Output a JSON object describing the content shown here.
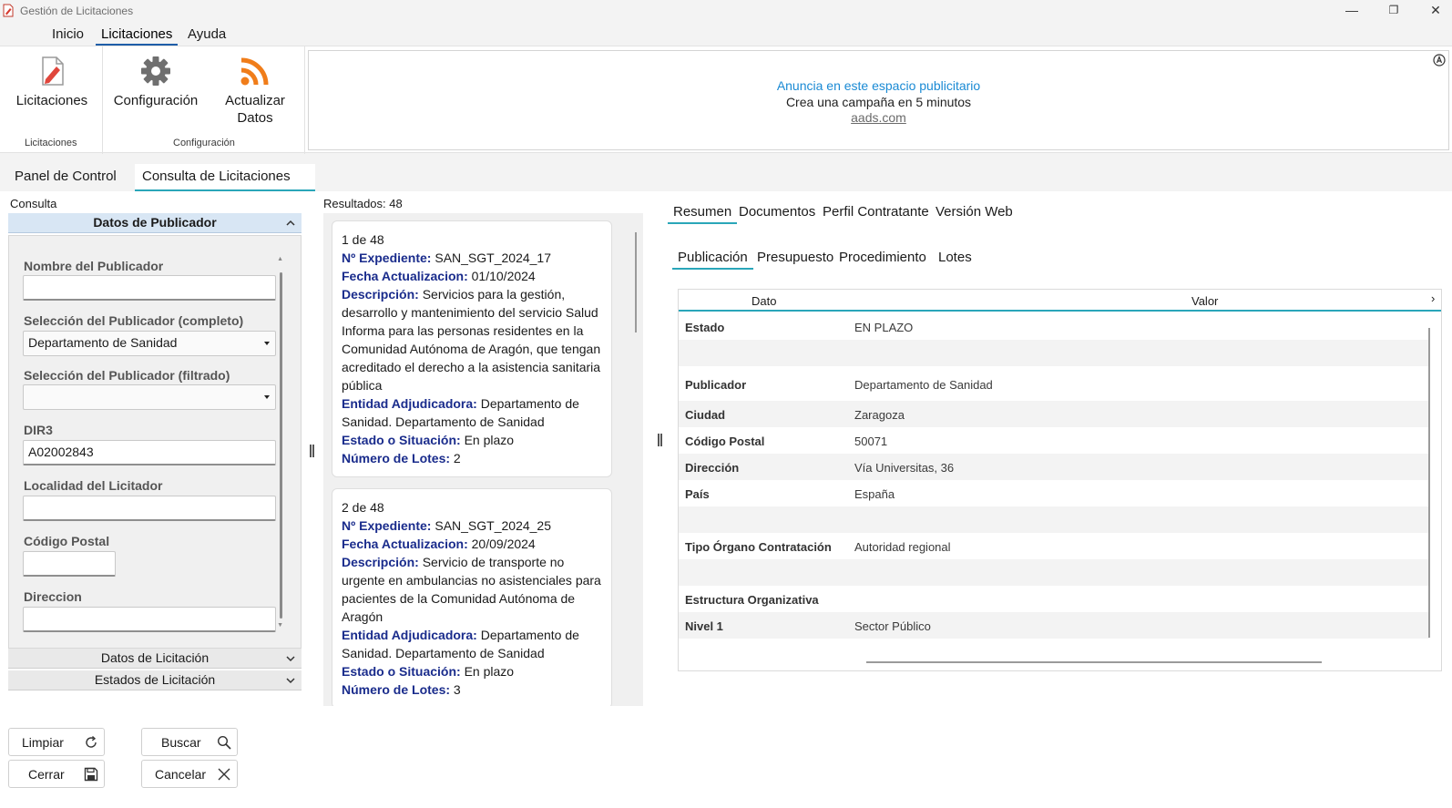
{
  "window": {
    "title": "Gestión de Licitaciones",
    "minimize_glyph": "—",
    "maximize_glyph": "❐",
    "close_glyph": "✕"
  },
  "menu": {
    "items": [
      "Inicio",
      "Licitaciones",
      "Ayuda"
    ],
    "active": "Licitaciones"
  },
  "ribbon": {
    "buttons": [
      {
        "label": "Licitaciones",
        "icon": "document-edit-icon"
      },
      {
        "label": "Configuración",
        "icon": "gear-icon"
      },
      {
        "label_line1": "Actualizar",
        "label_line2": "Datos",
        "icon": "rss-icon"
      }
    ],
    "groups": [
      "Licitaciones",
      "Configuración"
    ]
  },
  "ad": {
    "headline": "Anuncia en este espacio publicitario",
    "subline": "Crea una campaña en 5 minutos",
    "link": "aads.com"
  },
  "tabs": {
    "items": [
      "Panel de Control",
      "Consulta de Licitaciones"
    ],
    "active": "Consulta de Licitaciones"
  },
  "left": {
    "consulta_label": "Consulta",
    "accordion": {
      "publicador": "Datos de Publicador",
      "licitacion": "Datos de Licitación",
      "estados": "Estados de Licitación"
    },
    "form": {
      "nombre_label": "Nombre del Publicador",
      "nombre_value": "",
      "sel_completo_label": "Selección del Publicador (completo)",
      "sel_completo_value": "Departamento de Sanidad",
      "sel_filtrado_label": "Selección del Publicador (filtrado)",
      "sel_filtrado_value": "",
      "dir3_label": "DIR3",
      "dir3_value": "A02002843",
      "localidad_label": "Localidad del Licitador",
      "localidad_value": "",
      "cp_label": "Código Postal",
      "cp_value": "",
      "direccion_label": "Direccion",
      "direccion_value": ""
    },
    "buttons": {
      "limpiar": "Limpiar",
      "buscar": "Buscar",
      "cerrar": "Cerrar",
      "cancelar": "Cancelar"
    }
  },
  "results": {
    "label": "Resultados: 48",
    "field_labels": {
      "expediente": "Nº Expediente:",
      "fecha": "Fecha Actualizacion:",
      "descripcion": "Descripción:",
      "entidad": "Entidad Adjudicadora:",
      "estado": "Estado o Situación:",
      "lotes": "Número de Lotes:"
    },
    "cards": [
      {
        "index": "1 de 48",
        "expediente": "SAN_SGT_2024_17",
        "fecha": "01/10/2024",
        "descripcion": "Servicios para la gestión, desarrollo y mantenimiento del servicio Salud Informa para las personas residentes en la Comunidad Autónoma de Aragón, que tengan acreditado el derecho a la asistencia sanitaria pública",
        "entidad": "Departamento de Sanidad. Departamento de Sanidad",
        "estado": "En plazo",
        "lotes": "2"
      },
      {
        "index": "2 de 48",
        "expediente": "SAN_SGT_2024_25",
        "fecha": "20/09/2024",
        "descripcion": "Servicio de transporte no urgente en ambulancias no asistenciales para pacientes de la Comunidad Autónoma de Aragón",
        "entidad": "Departamento de Sanidad. Departamento de Sanidad",
        "estado": "En plazo",
        "lotes": "3"
      }
    ]
  },
  "detail": {
    "tabs": [
      "Resumen",
      "Documentos",
      "Perfil Contratante",
      "Versión Web"
    ],
    "subtabs": [
      "Publicación",
      "Presupuesto",
      "Procedimiento",
      "Lotes"
    ],
    "grid": {
      "col_dato": "Dato",
      "col_valor": "Valor",
      "rows": [
        {
          "key": "Estado",
          "value": "EN PLAZO"
        },
        {
          "key": "",
          "value": ""
        },
        {
          "key": "Publicador",
          "value": "Departamento de Sanidad"
        },
        {
          "key": "Ciudad",
          "value": "Zaragoza"
        },
        {
          "key": "Código Postal",
          "value": "50071"
        },
        {
          "key": "Dirección",
          "value": "Vía Universitas, 36"
        },
        {
          "key": "País",
          "value": "España"
        },
        {
          "key": "",
          "value": ""
        },
        {
          "key": "Tipo Órgano Contratación",
          "value": "Autoridad regional"
        },
        {
          "key": "",
          "value": ""
        },
        {
          "key": "Estructura Organizativa",
          "value": ""
        },
        {
          "key": "Nivel 1",
          "value": "Sector Público"
        }
      ]
    }
  }
}
